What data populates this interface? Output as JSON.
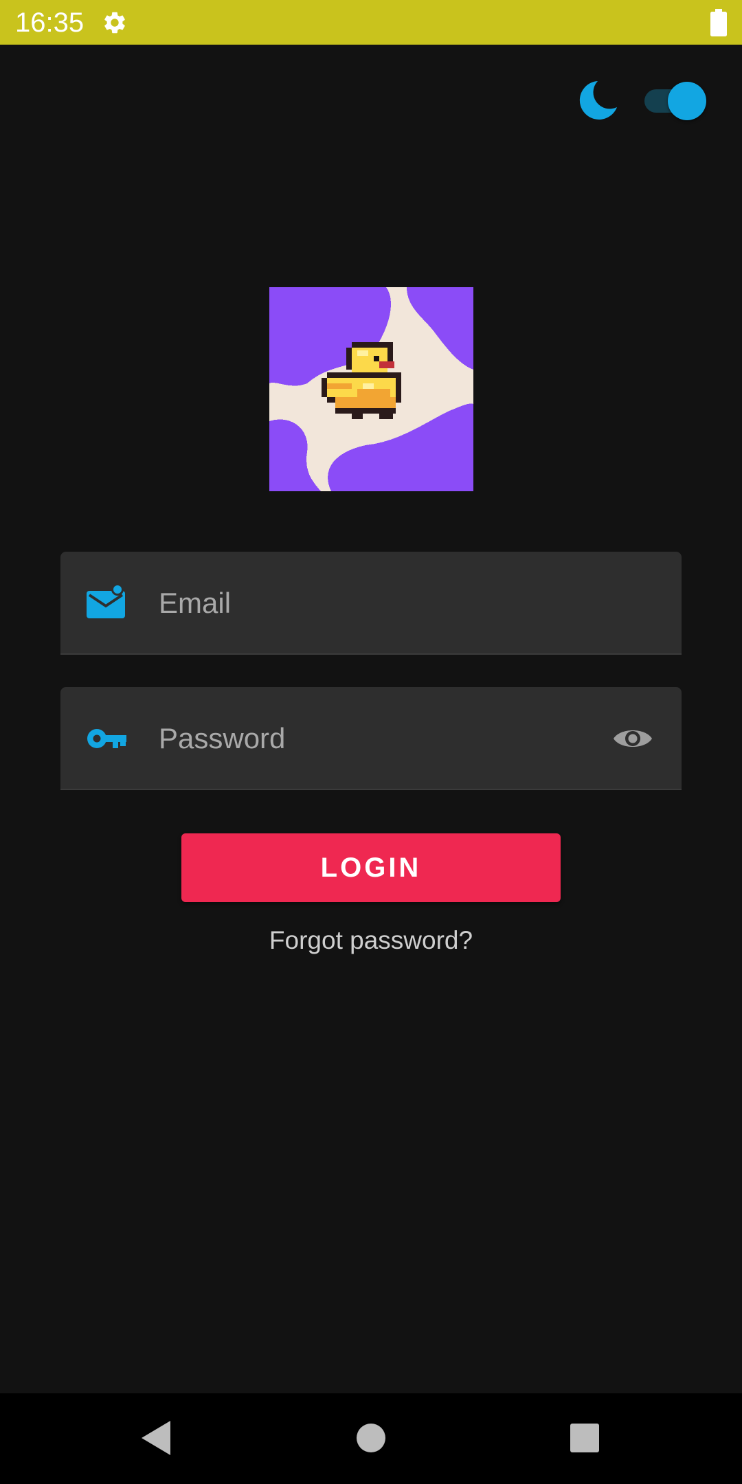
{
  "status_bar": {
    "time": "16:35",
    "background_color": "#c9c31d",
    "icons": [
      "gear-icon",
      "battery-icon"
    ]
  },
  "theme_toggle": {
    "icon": "moon-icon",
    "dark_mode_on": true,
    "accent_color": "#12a6e2"
  },
  "logo": {
    "description_icon": "pixel-duck-logo"
  },
  "email_field": {
    "placeholder": "Email",
    "value": "",
    "icon": "mail-icon"
  },
  "password_field": {
    "placeholder": "Password",
    "value": "",
    "icon": "key-icon",
    "visibility_icon": "eye-icon"
  },
  "login_button": {
    "label": "LOGIN",
    "color": "#ef2851"
  },
  "forgot_password": {
    "label": "Forgot password?"
  },
  "nav_bar": {
    "buttons": [
      "back-icon",
      "home-icon",
      "recents-icon"
    ]
  }
}
